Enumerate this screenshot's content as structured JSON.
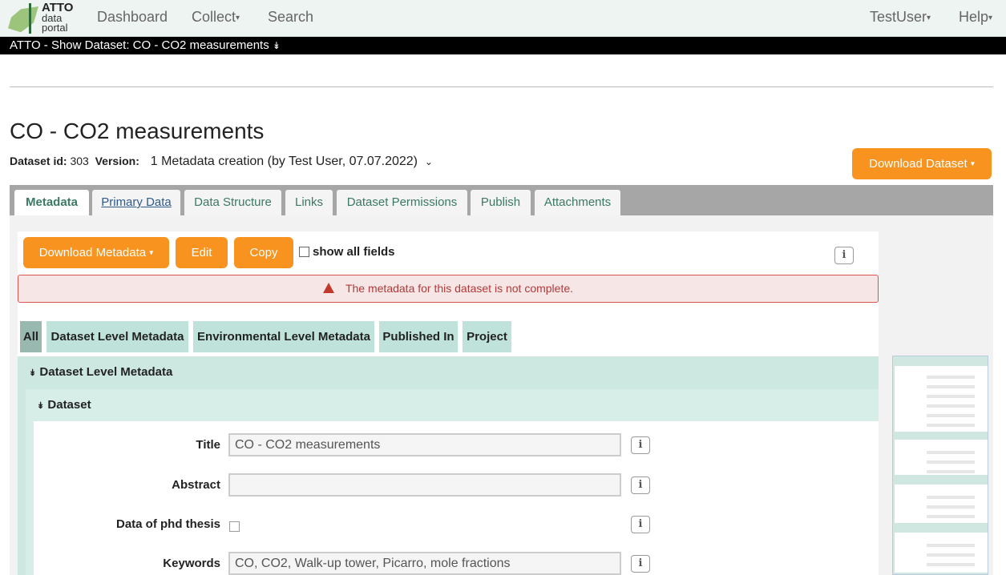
{
  "nav": {
    "logo_line1": "ATTO",
    "logo_line2": "data",
    "logo_line3": "portal",
    "dashboard": "Dashboard",
    "collect": "Collect",
    "search": "Search",
    "user": "TestUser",
    "help": "Help"
  },
  "breadcrumb": "ATTO - Show Dataset: CO - CO2 measurements",
  "title": "CO - CO2 measurements",
  "meta": {
    "id_label": "Dataset id:",
    "id_value": "303",
    "version_label": "Version:",
    "version_value": "1 Metadata creation (by Test User, 07.07.2022)"
  },
  "download_dataset": "Download Dataset",
  "tabs": [
    "Metadata",
    "Primary Data",
    "Data Structure",
    "Links",
    "Dataset Permissions",
    "Publish",
    "Attachments"
  ],
  "toolbar": {
    "download_metadata": "Download Metadata",
    "edit": "Edit",
    "copy": "Copy",
    "show_all": "show all fields"
  },
  "alert": "The metadata for this dataset is not complete.",
  "filters": [
    "All",
    "Dataset Level Metadata",
    "Environmental Level Metadata",
    "Published In",
    "Project"
  ],
  "section1": "Dataset Level Metadata",
  "section2": "Dataset",
  "fields": {
    "title_label": "Title",
    "title_value": "CO - CO2 measurements",
    "abstract_label": "Abstract",
    "abstract_value": "",
    "phd_label": "Data of phd thesis",
    "keywords_label": "Keywords",
    "keywords_value": "CO, CO2, Walk-up tower, Picarro, mole fractions"
  },
  "icons": {
    "info": "info-icon",
    "warning": "warning-icon",
    "collapse": "double-chevron-down-icon"
  },
  "colors": {
    "accent": "#f7931e",
    "section": "#cce8e1",
    "tab_text": "#3a7a63"
  }
}
